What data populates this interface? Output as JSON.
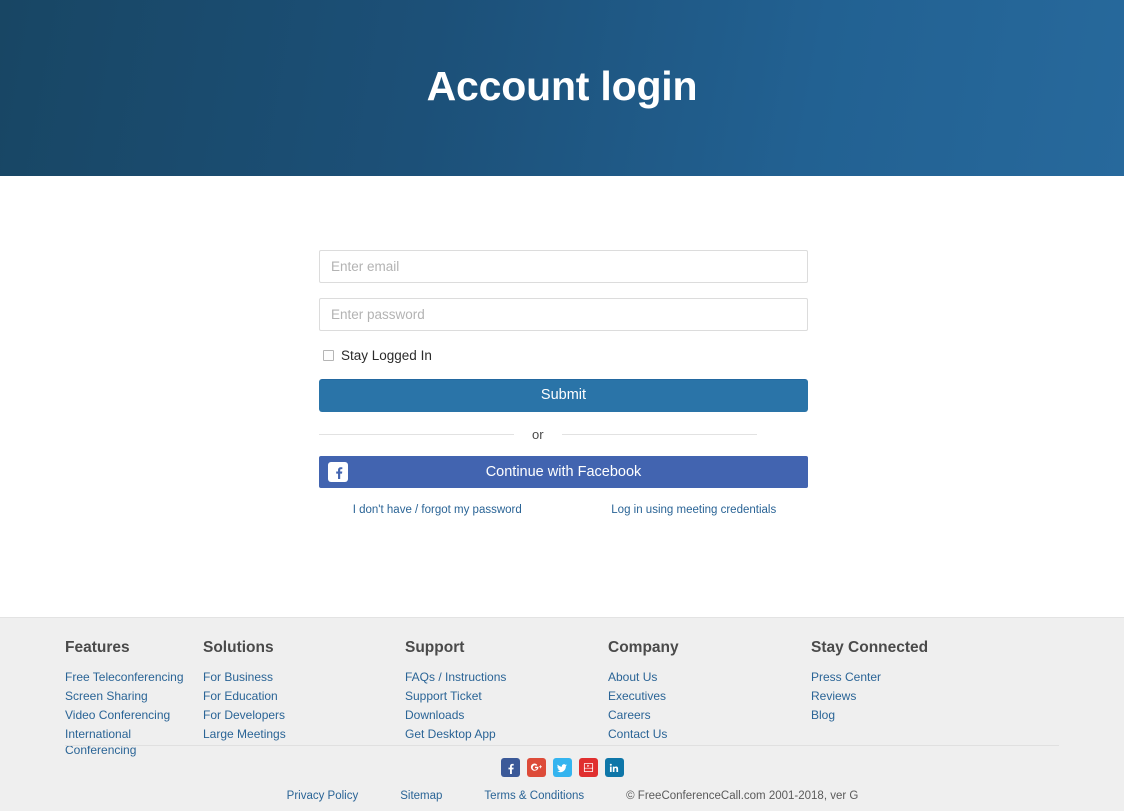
{
  "hero": {
    "title": "Account login",
    "gradient_from": "#184664",
    "gradient_to": "#27699c"
  },
  "login": {
    "email_placeholder": "Enter email",
    "email_value": "",
    "password_placeholder": "Enter password",
    "password_value": "",
    "stay_logged_in_label": "Stay Logged In",
    "stay_logged_in_checked": false,
    "submit_label": "Submit",
    "submit_color": "#2a74a8",
    "or_label": "or",
    "facebook_label": "Continue with Facebook",
    "facebook_color": "#4264b0",
    "forgot_password_link": "I don't have / forgot my password",
    "meeting_credentials_link": "Log in using meeting credentials",
    "link_color": "#2a6496"
  },
  "footer": {
    "columns": [
      {
        "heading": "Features",
        "links": [
          "Free Teleconferencing",
          "Screen Sharing",
          "Video Conferencing",
          "International Conferencing"
        ]
      },
      {
        "heading": "Solutions",
        "links": [
          "For Business",
          "For Education",
          "For Developers",
          "Large Meetings"
        ]
      },
      {
        "heading": "Support",
        "links": [
          "FAQs / Instructions",
          "Support Ticket",
          "Downloads",
          "Get Desktop App"
        ]
      },
      {
        "heading": "Company",
        "links": [
          "About Us",
          "Executives",
          "Careers",
          "Contact Us"
        ]
      },
      {
        "heading": "Stay Connected",
        "links": [
          "Press Center",
          "Reviews",
          "Blog"
        ]
      }
    ],
    "social": [
      {
        "name": "facebook",
        "color": "#3b5998"
      },
      {
        "name": "google-plus",
        "color": "#dd4b39"
      },
      {
        "name": "twitter",
        "color": "#34b4ef"
      },
      {
        "name": "youtube",
        "color": "#e02f2f"
      },
      {
        "name": "linkedin",
        "color": "#0e76a8"
      }
    ],
    "bottom_links": [
      "Privacy Policy",
      "Sitemap",
      "Terms & Conditions"
    ],
    "copyright": "© FreeConferenceCall.com 2001-2018, ver G",
    "background": "#efefef"
  }
}
